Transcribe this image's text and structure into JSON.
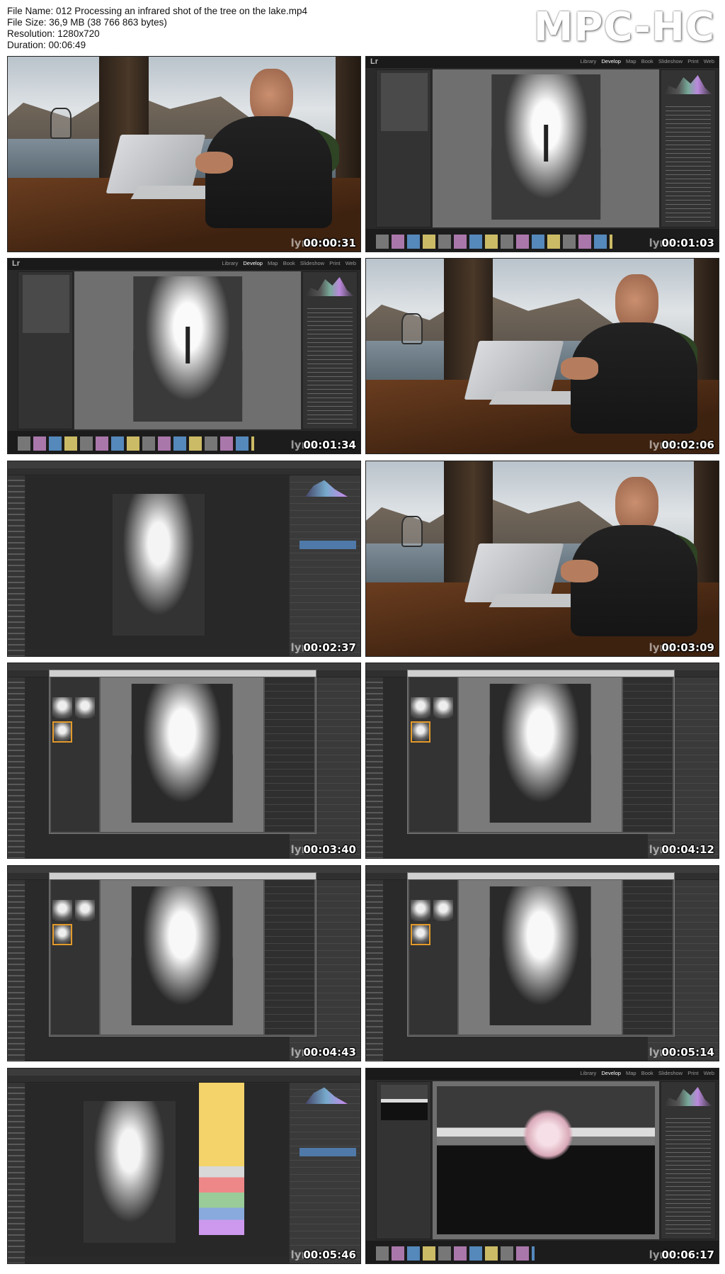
{
  "header": {
    "file_name_line": "File Name: 012 Processing an infrared shot of the tree on the lake.mp4",
    "file_size_line": "File Size: 36,9 MB (38 766 863 bytes)",
    "resolution_line": "Resolution: 1280x720",
    "duration_line": "Duration: 00:06:49",
    "brand": "MPC-HC"
  },
  "watermark": "lynd",
  "lr_modules": [
    "Library",
    "Develop",
    "Map",
    "Book",
    "Slideshow",
    "Print",
    "Web"
  ],
  "lr_logo": "Lr",
  "thumbnails": [
    {
      "timestamp": "00:00:31",
      "kind": "video"
    },
    {
      "timestamp": "00:01:03",
      "kind": "lightroom"
    },
    {
      "timestamp": "00:01:34",
      "kind": "lightroom"
    },
    {
      "timestamp": "00:02:06",
      "kind": "video"
    },
    {
      "timestamp": "00:02:37",
      "kind": "photoshop"
    },
    {
      "timestamp": "00:03:09",
      "kind": "video"
    },
    {
      "timestamp": "00:03:40",
      "kind": "silver-efex"
    },
    {
      "timestamp": "00:04:12",
      "kind": "silver-efex"
    },
    {
      "timestamp": "00:04:43",
      "kind": "silver-efex"
    },
    {
      "timestamp": "00:05:14",
      "kind": "silver-efex"
    },
    {
      "timestamp": "00:05:46",
      "kind": "photoshop-panel"
    },
    {
      "timestamp": "00:06:17",
      "kind": "lightroom-final"
    }
  ],
  "colors": {
    "lightroom_bg": "#2a2a2a",
    "selection_orange": "#e39a2a",
    "layer_blue": "#4f79a8",
    "brand_white": "#ffffff"
  }
}
